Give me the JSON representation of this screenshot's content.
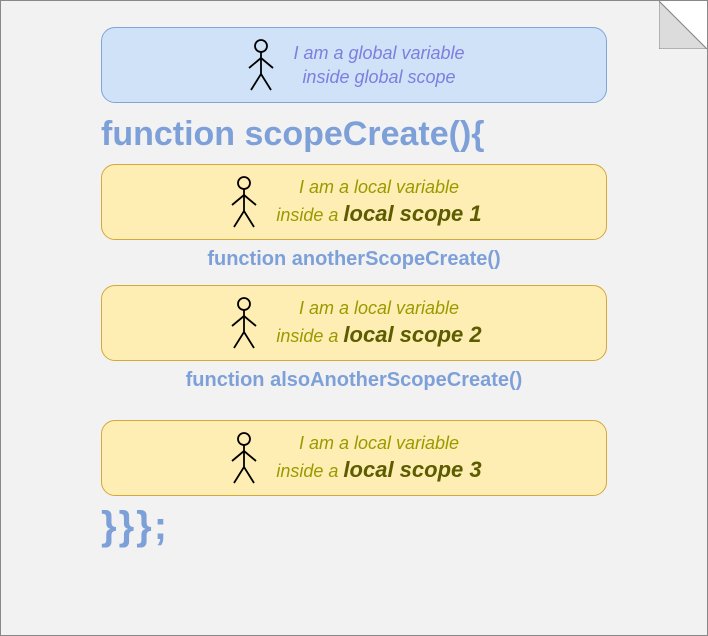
{
  "global": {
    "line1": "I am a global variable",
    "line2": "inside global scope"
  },
  "fn_outer": "function scopeCreate(){",
  "local1": {
    "line1": "I am a local variable",
    "line2_prefix": "inside a ",
    "line2_em": "local scope 1"
  },
  "fn_mid1": "function anotherScopeCreate()",
  "local2": {
    "line1": "I am a local variable",
    "line2_prefix": "inside a ",
    "line2_em": "local scope 2"
  },
  "fn_mid2": "function alsoAnotherScopeCreate()",
  "local3": {
    "line1": "I am a local variable",
    "line2_prefix": "inside a ",
    "line2_em": "local scope 3"
  },
  "fn_close": "}}};"
}
